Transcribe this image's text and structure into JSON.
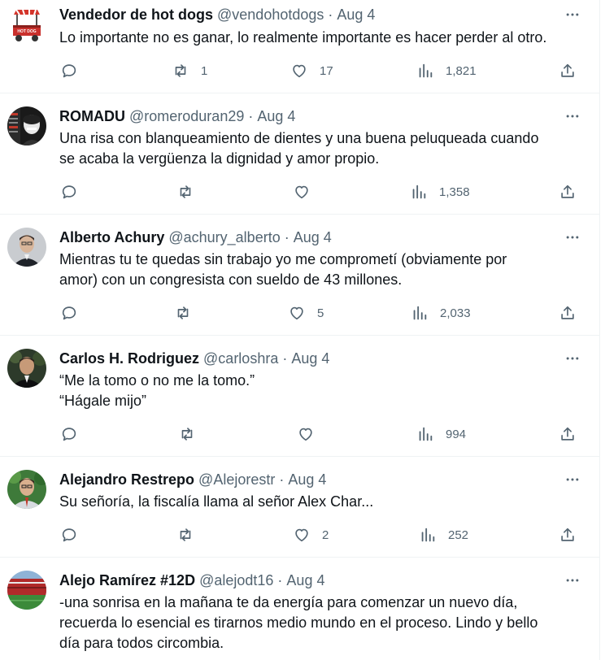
{
  "tweets": [
    {
      "name": "Vendedor de hot dogs",
      "handle": "@vendohotdogs",
      "sep": "·",
      "time": "Aug 4",
      "lines": [
        "Lo importante no es ganar, lo realmente importante es hacer perder al otro."
      ],
      "avatar_icon": "hotdog-cart-icon",
      "avatar_label": "HOT DOG",
      "retweets": "1",
      "likes": "17",
      "views": "1,821"
    },
    {
      "name": "ROMADU",
      "handle": "@romeroduran29",
      "sep": "·",
      "time": "Aug 4",
      "lines": [
        "Una risa con blanqueamiento de dientes y una buena peluqueada cuando",
        "se acaba la vergüenza la dignidad y amor propio."
      ],
      "avatar_icon": "profile-photo-icon",
      "retweets": "",
      "likes": "",
      "views": "1,358"
    },
    {
      "name": "Alberto Achury",
      "handle": "@achury_alberto",
      "sep": "·",
      "time": "Aug 4",
      "lines": [
        "Mientras tu te quedas sin trabajo yo me comprometí (obviamente por",
        "amor) con un congresista con sueldo de 43 millones."
      ],
      "avatar_icon": "profile-photo-icon",
      "retweets": "",
      "likes": "5",
      "views": "2,033"
    },
    {
      "name": "Carlos H. Rodriguez",
      "handle": "@carloshra",
      "sep": "·",
      "time": "Aug 4",
      "lines": [
        "“Me la tomo o no me la tomo.”",
        "“Hágale mijo”"
      ],
      "avatar_icon": "profile-photo-icon",
      "retweets": "",
      "likes": "",
      "views": "994"
    },
    {
      "name": "Alejandro Restrepo",
      "handle": "@Alejorestr",
      "sep": "·",
      "time": "Aug 4",
      "lines": [
        "Su señoría, la fiscalía llama al señor Alex Char..."
      ],
      "avatar_icon": "profile-photo-icon",
      "retweets": "",
      "likes": "2",
      "views": "252"
    },
    {
      "name": "Alejo Ramírez #12D",
      "handle": "@alejodt16",
      "sep": "·",
      "time": "Aug 4",
      "lines": [
        "-una sonrisa en la mañana te da energía para comenzar un nuevo día,",
        "recuerda lo esencial es tirarnos medio mundo en el proceso. Lindo y bello",
        "día para todos circombia."
      ],
      "avatar_icon": "stadium-photo-icon",
      "retweets": "",
      "likes": "",
      "views": ""
    }
  ],
  "icons": {
    "more": "more-icon",
    "reply": "reply-icon",
    "retweet": "retweet-icon",
    "like": "like-icon",
    "views": "views-icon",
    "share": "share-icon"
  },
  "colors": {
    "text": "#0f1419",
    "muted": "#536471",
    "divider": "#eff3f4"
  }
}
